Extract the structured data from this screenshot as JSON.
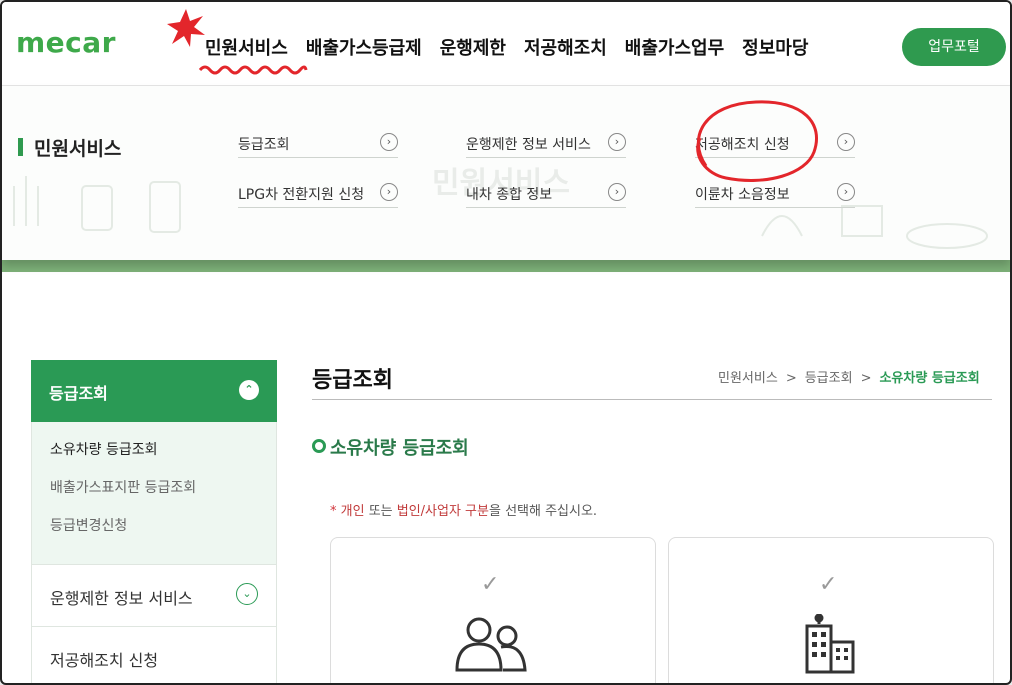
{
  "header": {
    "logo": "mecar",
    "nav": [
      "민원서비스",
      "배출가스등급제",
      "운행제한",
      "저공해조치",
      "배출가스업무",
      "정보마당"
    ],
    "portal_button": "업무포털"
  },
  "mega_menu": {
    "title": "민원서비스",
    "watermark": "민원서비스",
    "links": [
      {
        "label": "등급조회"
      },
      {
        "label": "LPG차 전환지원 신청"
      },
      {
        "label": "운행제한 정보 서비스"
      },
      {
        "label": "내차 종합 정보"
      },
      {
        "label": "저공해조치 신청"
      },
      {
        "label": "이륜차 소음정보"
      }
    ]
  },
  "sidebar": {
    "head": "등급조회",
    "sub_items": [
      "소유차량 등급조회",
      "배출가스표지판 등급조회",
      "등급변경신청"
    ],
    "items": [
      "운행제한 정보 서비스",
      "저공해조치 신청"
    ]
  },
  "content": {
    "title": "등급조회",
    "breadcrumb": [
      "민원서비스",
      "등급조회",
      "소유차량 등급조회"
    ],
    "section_title": "소유차량 등급조회",
    "notice": {
      "prefix": "* ",
      "w1": "개인",
      "w2": " 또는 ",
      "w3": "법인/사업자 구분",
      "w4": "을 선택해 주십시오."
    }
  },
  "colors": {
    "brand_green": "#2f9a4f",
    "annotation_red": "#e3262b"
  }
}
